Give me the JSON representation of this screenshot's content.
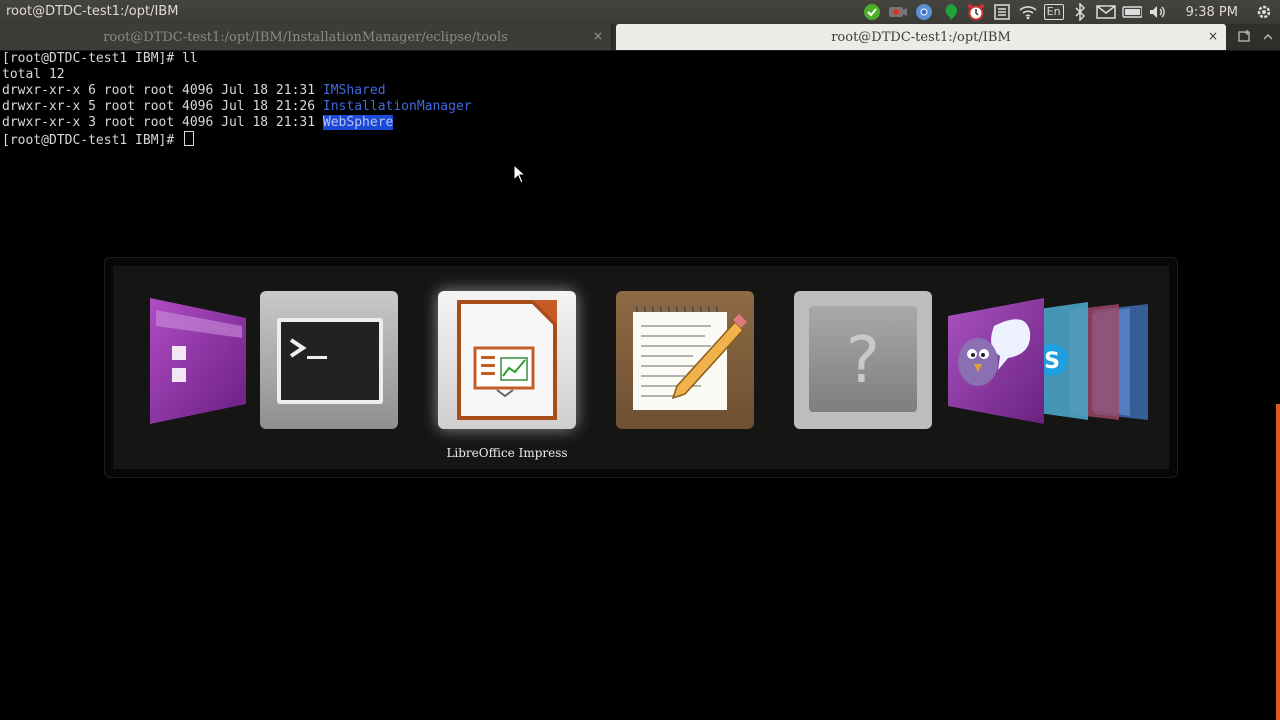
{
  "top_panel": {
    "window_title": "root@DTDC-test1:/opt/IBM",
    "clock": "9:38 PM",
    "keyboard_layout": "En",
    "tray_icons": [
      "check-icon",
      "video-record-icon",
      "chromium-icon",
      "hangouts-icon",
      "alarm-clock-icon",
      "notes-icon",
      "wifi-icon",
      "keyboard-layout-icon",
      "bluetooth-icon",
      "mail-icon",
      "battery-icon",
      "volume-icon",
      "power-gear-icon"
    ]
  },
  "tabs": [
    {
      "label": "root@DTDC-test1:/opt/IBM/InstallationManager/eclipse/tools",
      "close": "×",
      "active": false
    },
    {
      "label": "root@DTDC-test1:/opt/IBM",
      "close": "×",
      "active": true
    }
  ],
  "terminal": {
    "lines": [
      {
        "prefix": "[root@DTDC-test1 IBM]# ll",
        "name": ""
      },
      {
        "prefix": "total 12",
        "name": ""
      },
      {
        "prefix": "drwxr-xr-x 6 root root 4096 Jul 18 21:31 ",
        "name": "IMShared"
      },
      {
        "prefix": "drwxr-xr-x 5 root root 4096 Jul 18 21:26 ",
        "name": "InstallationManager"
      },
      {
        "prefix": "drwxr-xr-x 3 root root 4096 Jul 18 21:31 ",
        "name": "WebSphere"
      },
      {
        "prefix": "[root@DTDC-test1 IBM]# ",
        "name": ""
      }
    ],
    "selected_entry": "WebSphere",
    "dir_color": "#3e6ae0"
  },
  "switcher": {
    "apps": [
      "files-app-icon",
      "terminal-app-icon",
      "libreoffice-impress-icon",
      "text-editor-icon",
      "unknown-app-icon",
      "pidgin-icon",
      "skype-icon"
    ],
    "selected_label": "LibreOffice Impress"
  },
  "colors": {
    "scrollbar": "#e05a1e",
    "selection": "#1a48d8"
  }
}
